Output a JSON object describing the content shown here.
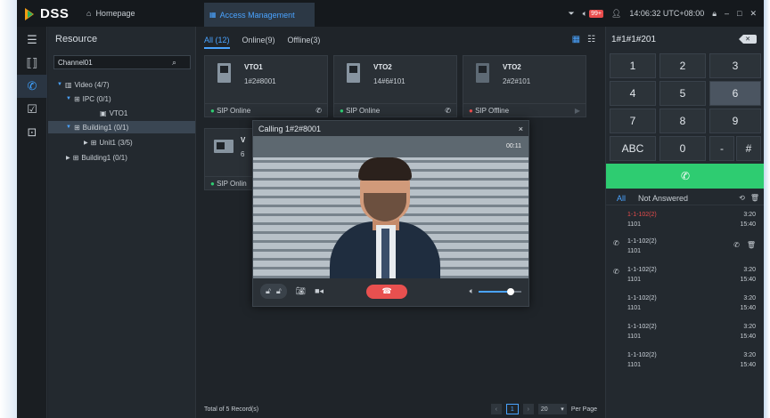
{
  "app": {
    "brand": "DSS"
  },
  "titlebar": {
    "home_tab": "Homepage",
    "access_tab": "Access Management",
    "notif_count": "99+",
    "time": "14:06:32 UTC+08:00"
  },
  "resource": {
    "title": "Resource",
    "search_value": "Channel01",
    "tree": [
      {
        "label": "Video (4/7)"
      },
      {
        "label": "IPC (0/1)"
      },
      {
        "label": "VTO1"
      },
      {
        "label": "Building1 (0/1)"
      },
      {
        "label": "Unit1 (3/5)"
      },
      {
        "label": "Building1 (0/1)"
      }
    ]
  },
  "main": {
    "filters": [
      {
        "label": "All  (12)"
      },
      {
        "label": "Online(9)"
      },
      {
        "label": "Offline(3)"
      }
    ],
    "cards": [
      {
        "name": "VTO1",
        "number": "1#2#8001",
        "status": "SIP Online"
      },
      {
        "name": "VTO2",
        "number": "14#6#101",
        "status": "SIP Online"
      },
      {
        "name": "VTO2",
        "number": "2#2#101",
        "status": "SIP Offline"
      },
      {
        "name": "V",
        "number": "6",
        "status": "SIP Onlin"
      }
    ],
    "total": "Total of 5 Record(s)",
    "page": "1",
    "page_size": "20",
    "per_page": "Per Page"
  },
  "dialog": {
    "title": "Calling 1#2#8001",
    "close": "×",
    "timer": "00:11",
    "volume_level": 0.75
  },
  "dial": {
    "input": "1#1#1#201",
    "keys": [
      "1",
      "2",
      "3",
      "4",
      "5",
      "6",
      "7",
      "8",
      "9",
      "ABC",
      "0",
      "-",
      "#"
    ],
    "tabs": {
      "all": "All",
      "not_answered": "Not Answered"
    },
    "records": [
      {
        "line1": "1-1-102(2)",
        "line2": "1101",
        "t1": "3:20",
        "t2": "15:40",
        "missed": true,
        "icon": ""
      },
      {
        "line1": "1-1-102(2)",
        "line2": "1101",
        "t1": "",
        "t2": "",
        "missed": false,
        "icon": "call-icon"
      },
      {
        "line1": "1-1-102(2)",
        "line2": "1101",
        "t1": "3:20",
        "t2": "15:40",
        "missed": false,
        "icon": "call-icon"
      },
      {
        "line1": "1-1-102(2)",
        "line2": "1101",
        "t1": "3:20",
        "t2": "15:40",
        "missed": false,
        "icon": ""
      },
      {
        "line1": "1-1-102(2)",
        "line2": "1101",
        "t1": "3:20",
        "t2": "15:40",
        "missed": false,
        "icon": ""
      },
      {
        "line1": "1-1-102(2)",
        "line2": "1101",
        "t1": "3:20",
        "t2": "15:40",
        "missed": false,
        "icon": ""
      }
    ]
  },
  "colors": {
    "accent": "#4aa3ff",
    "online": "#2ecc71",
    "offline": "#e84c4c",
    "call": "#2ecc71",
    "hangup": "#e8504f"
  }
}
